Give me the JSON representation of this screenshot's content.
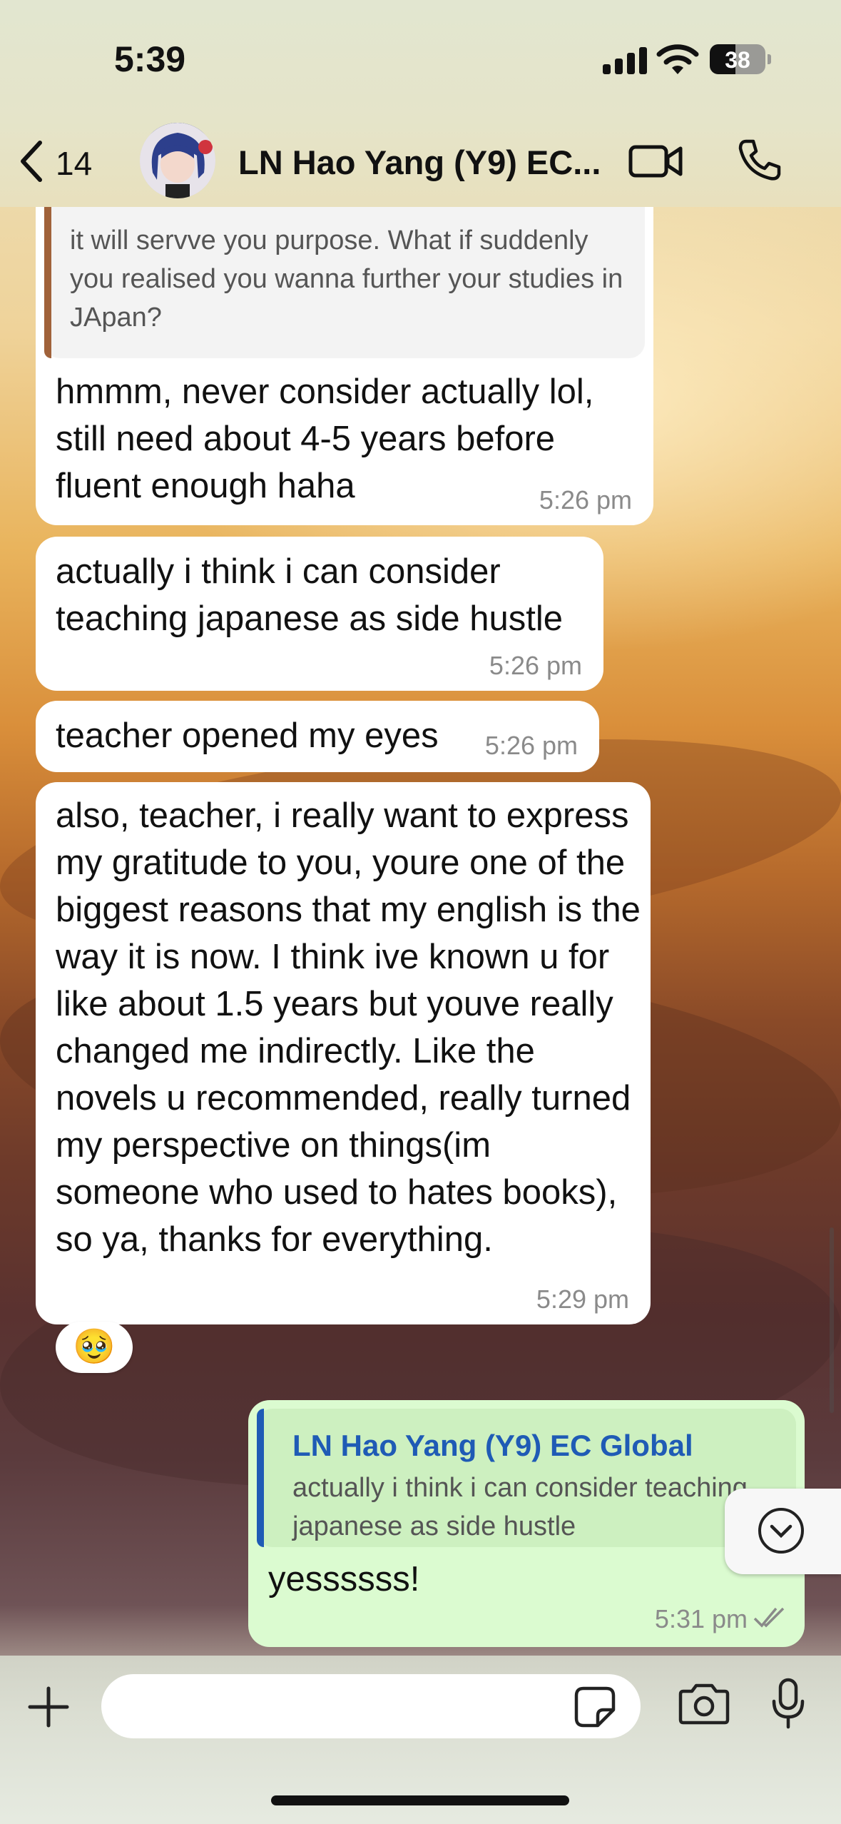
{
  "status_bar": {
    "time": "5:39",
    "battery": "38"
  },
  "header": {
    "back_count": "14",
    "title": "LN Hao Yang (Y9) EC..."
  },
  "messages": {
    "m1": {
      "quote": "it will servve you purpose. What if suddenly you realised you wanna further your studies in JApan?",
      "text": "hmmm, never consider actually lol, still need about 4-5 years before fluent enough haha",
      "time": "5:26 pm"
    },
    "m2": {
      "text": "actually i think i can consider teaching japanese as side hustle",
      "time": "5:26 pm"
    },
    "m3": {
      "text": "teacher opened my eyes",
      "time": "5:26 pm"
    },
    "m4": {
      "text": "also, teacher, i really want to express my gratitude to you, youre one of the biggest reasons that my english is the way it is now. I think ive known u for like about 1.5 years but youve really changed me indirectly. Like the novels u recommended, really turned my perspective on things(im someone who used to hates books), so ya, thanks for everything.",
      "time": "5:29 pm",
      "reaction": "🥹"
    },
    "m5": {
      "quote_sender": "LN Hao Yang (Y9) EC Global",
      "quote": "actually i think i can consider teaching japanese as side hustle",
      "text": "yessssss!",
      "time": "5:31 pm"
    }
  },
  "icons": [
    "back-chevron-icon",
    "video-call-icon",
    "phone-call-icon",
    "plus-icon",
    "sticker-icon",
    "camera-icon",
    "microphone-icon",
    "chevron-down-icon",
    "read-receipt-icon"
  ],
  "colors": {
    "outgoing_bubble": "#dbfbd0",
    "incoming_bubble": "#ffffff",
    "quote_bar_in": "#a0623a",
    "quote_bar_out": "#1f5bb5"
  }
}
